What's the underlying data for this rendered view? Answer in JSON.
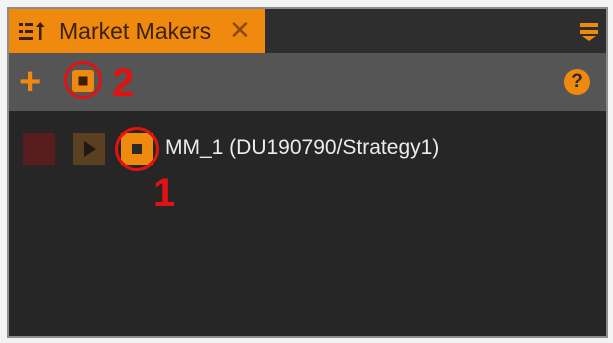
{
  "panel": {
    "tab_title": "Market Makers",
    "tab_close": "✕",
    "icons": {
      "tab": "list-sort-icon",
      "menu": "hamburger-menu-icon",
      "add": "plus-icon",
      "stop_all": "stop-icon",
      "help": "help-icon"
    }
  },
  "toolbar": {
    "add_label": "+",
    "help_label": "?"
  },
  "market_makers": [
    {
      "label": "MM_1 (DU190790/Strategy1)"
    }
  ],
  "annotations": {
    "one": "1",
    "two": "2"
  },
  "colors": {
    "accent": "#ef8a0f",
    "annotation": "#e31212",
    "panel_bg": "#262626",
    "toolbar_bg": "#555555"
  }
}
